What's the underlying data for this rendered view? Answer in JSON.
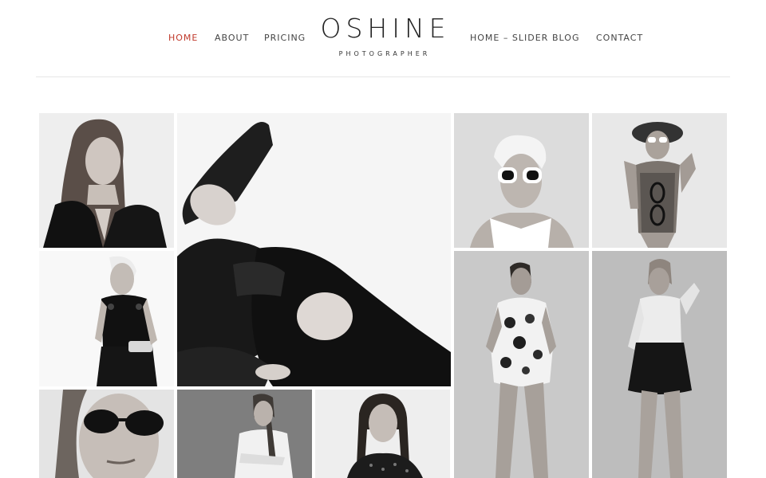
{
  "header": {
    "nav_left": [
      "HOME",
      "ABOUT",
      "PRICING"
    ],
    "nav_right": [
      "HOME – SLIDER",
      "BLOG",
      "CONTACT"
    ],
    "active_item": "HOME",
    "logo_title": "OSHINE",
    "logo_subtitle": "PHOTOGRAPHER"
  },
  "colors": {
    "accent": "#c0392b",
    "nav_text": "#444444",
    "divider": "#e6e6e6"
  },
  "gallery": {
    "photos": [
      "portrait-woman-black-jacket",
      "reclining-woman-black-lingerie",
      "woman-white-sunglasses-short-hair",
      "woman-hat-swimsuit",
      "woman-short-hair-black-dress",
      "woman-floral-dress",
      "woman-white-shirt-black-skirt",
      "woman-black-round-sunglasses",
      "woman-white-shirt-braid",
      "woman-dark-hair-dotted-top"
    ]
  }
}
